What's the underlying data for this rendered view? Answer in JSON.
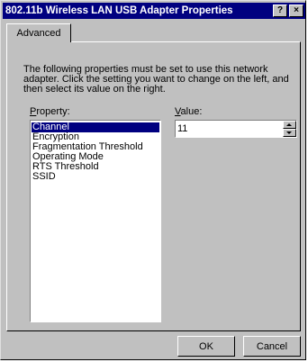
{
  "window": {
    "title": "802.11b Wireless LAN USB Adapter Properties",
    "help_button": "?",
    "close_button": "×"
  },
  "tabs": [
    {
      "label": "Advanced",
      "selected": true
    }
  ],
  "description": "The following properties must be set to use this network adapter. Click the setting you want to change on the left, and then select its value on the right.",
  "property": {
    "label_accel": "P",
    "label_rest": "roperty:",
    "items": [
      {
        "label": "Channel",
        "selected": true
      },
      {
        "label": "Encryption",
        "selected": false
      },
      {
        "label": "Fragmentation Threshold",
        "selected": false
      },
      {
        "label": "Operating Mode",
        "selected": false
      },
      {
        "label": "RTS Threshold",
        "selected": false
      },
      {
        "label": "SSID",
        "selected": false
      }
    ]
  },
  "value": {
    "label_accel": "V",
    "label_rest": "alue:",
    "current": "11"
  },
  "buttons": {
    "ok": "OK",
    "cancel": "Cancel"
  }
}
